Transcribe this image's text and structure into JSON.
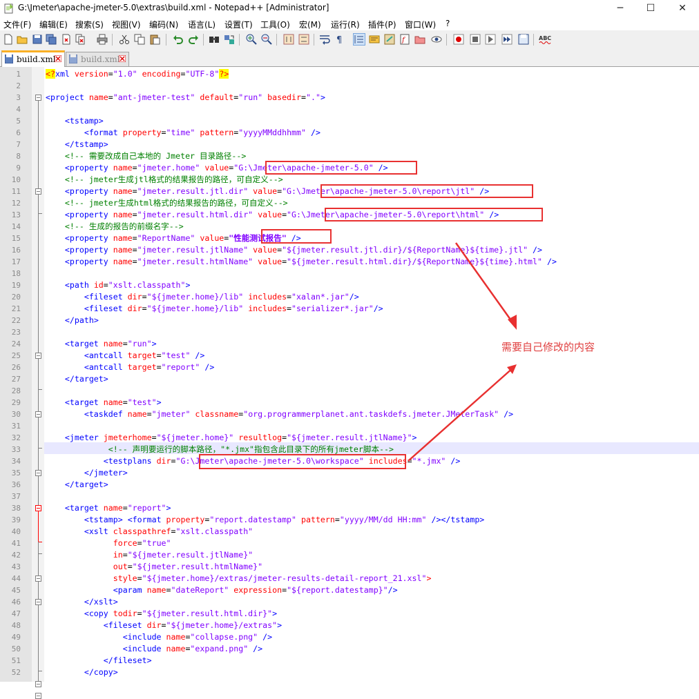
{
  "window": {
    "title": "G:\\Jmeter\\apache-jmeter-5.0\\extras\\build.xml - Notepad++ [Administrator]",
    "minimize_glyph": "─",
    "maximize_glyph": "☐",
    "close_glyph": "✕"
  },
  "menu": [
    "文件(F)",
    "编辑(E)",
    "搜索(S)",
    "视图(V)",
    "编码(N)",
    "语言(L)",
    "设置(T)",
    "工具(O)",
    "宏(M)",
    "运行(R)",
    "插件(P)",
    "窗口(W)",
    "?"
  ],
  "toolbar_icons": [
    "new-file-icon",
    "open-file-icon",
    "save-icon",
    "save-all-icon",
    "close-icon",
    "close-all-icon",
    "print-icon",
    "cut-icon",
    "copy-icon",
    "paste-icon",
    "undo-icon",
    "redo-icon",
    "find-icon",
    "replace-icon",
    "zoom-in-icon",
    "zoom-out-icon",
    "sync-vertical-icon",
    "sync-horizontal-icon",
    "word-wrap-icon",
    "show-all-chars-icon",
    "indent-guide-icon",
    "user-language-icon",
    "doc-map-icon",
    "function-list-icon",
    "folder-workspace-icon",
    "monitoring-icon",
    "macro-record-icon",
    "macro-stop-icon",
    "macro-play-icon",
    "macro-run-multiple-icon",
    "macro-save-icon",
    "spell-check-icon"
  ],
  "tabs": [
    {
      "label": "build.xml",
      "active": true
    },
    {
      "label": "build.xml",
      "active": false
    }
  ],
  "annotation": "需要自己修改的内容",
  "colors": {
    "tag": "#0000ff",
    "attr": "#ff0000",
    "value": "#8000ff",
    "comment": "#008000",
    "highlight_box": "#e83030",
    "current_line": "#e8e8ff"
  },
  "lines": [
    {
      "n": "1",
      "text": "<?xml version=\"1.0\" encoding=\"UTF-8\"?>"
    },
    {
      "n": "2",
      "text": ""
    },
    {
      "n": "3",
      "text": "<project name=\"ant-jmeter-test\" default=\"run\" basedir=\".\">"
    },
    {
      "n": "4",
      "text": ""
    },
    {
      "n": "5",
      "text": "    <tstamp>"
    },
    {
      "n": "6",
      "text": "        <format property=\"time\" pattern=\"yyyyMMddhhmm\" />"
    },
    {
      "n": "7",
      "text": "    </tstamp>"
    },
    {
      "n": "8",
      "text": "    <!-- 需要改成自己本地的 Jmeter 目录路径-->"
    },
    {
      "n": "9",
      "text": "    <property name=\"jmeter.home\" value=\"G:\\Jmeter\\apache-jmeter-5.0\" />"
    },
    {
      "n": "10",
      "text": "    <!-- jmeter生成jtl格式的结果报告的路径，可自定义-->"
    },
    {
      "n": "11",
      "text": "    <property name=\"jmeter.result.jtl.dir\" value=\"G:\\Jmeter\\apache-jmeter-5.0\\report\\jtl\" />"
    },
    {
      "n": "12",
      "text": "    <!-- jmeter生成html格式的结果报告的路径，可自定义-->"
    },
    {
      "n": "13",
      "text": "    <property name=\"jmeter.result.html.dir\" value=\"G:\\Jmeter\\apache-jmeter-5.0\\report\\html\" />"
    },
    {
      "n": "14",
      "text": "    <!-- 生成的报告的前缀名字-->"
    },
    {
      "n": "15",
      "text": "    <property name=\"ReportName\" value=\"性能测试报告\" />"
    },
    {
      "n": "16",
      "text": "    <property name=\"jmeter.result.jtlName\" value=\"${jmeter.result.jtl.dir}/${ReportName}${time}.jtl\" />"
    },
    {
      "n": "17",
      "text": "    <property name=\"jmeter.result.htmlName\" value=\"${jmeter.result.html.dir}/${ReportName}${time}.html\" />"
    },
    {
      "n": "18",
      "text": ""
    },
    {
      "n": "19",
      "text": "    <path id=\"xslt.classpath\">"
    },
    {
      "n": "20",
      "text": "        <fileset dir=\"${jmeter.home}/lib\" includes=\"xalan*.jar\"/>"
    },
    {
      "n": "21",
      "text": "        <fileset dir=\"${jmeter.home}/lib\" includes=\"serializer*.jar\"/>"
    },
    {
      "n": "22",
      "text": "    </path>"
    },
    {
      "n": "23",
      "text": ""
    },
    {
      "n": "24",
      "text": "    <target name=\"run\">"
    },
    {
      "n": "25",
      "text": "        <antcall target=\"test\" />"
    },
    {
      "n": "26",
      "text": "        <antcall target=\"report\" />"
    },
    {
      "n": "27",
      "text": "    </target>"
    },
    {
      "n": "28",
      "text": ""
    },
    {
      "n": "29",
      "text": "    <target name=\"test\">"
    },
    {
      "n": "30",
      "text": "        <taskdef name=\"jmeter\" classname=\"org.programmerplanet.ant.taskdefs.jmeter.JMeterTask\" />"
    },
    {
      "n": "31",
      "text": ""
    },
    {
      "n": "32",
      "text": "    <jmeter jmeterhome=\"${jmeter.home}\" resultlog=\"${jmeter.result.jtlName}\">"
    },
    {
      "n": "33",
      "text": "             <!-- 声明要运行的脚本路径，\"*.jmx\"指包含此目录下的所有jmeter脚本-->"
    },
    {
      "n": "34",
      "text": "            <testplans dir=\"G:\\Jmeter\\apache-jmeter-5.0\\workspace\" includes=\"*.jmx\" />"
    },
    {
      "n": "35",
      "text": "        </jmeter>"
    },
    {
      "n": "36",
      "text": "    </target>"
    },
    {
      "n": "37",
      "text": ""
    },
    {
      "n": "38",
      "text": "    <target name=\"report\">"
    },
    {
      "n": "39",
      "text": "        <tstamp> <format property=\"report.datestamp\" pattern=\"yyyy/MM/dd HH:mm\" /></tstamp>"
    },
    {
      "n": "40",
      "text": "        <xslt classpathref=\"xslt.classpath\""
    },
    {
      "n": "41",
      "text": "              force=\"true\""
    },
    {
      "n": "42",
      "text": "              in=\"${jmeter.result.jtlName}\""
    },
    {
      "n": "43",
      "text": "              out=\"${jmeter.result.htmlName}\""
    },
    {
      "n": "44",
      "text": "              style=\"${jmeter.home}/extras/jmeter-results-detail-report_21.xsl\">"
    },
    {
      "n": "45",
      "text": "              <param name=\"dateReport\" expression=\"${report.datestamp}\"/>"
    },
    {
      "n": "46",
      "text": "        </xslt>"
    },
    {
      "n": "47",
      "text": "        <copy todir=\"${jmeter.result.html.dir}\">"
    },
    {
      "n": "48",
      "text": "            <fileset dir=\"${jmeter.home}/extras\">"
    },
    {
      "n": "49",
      "text": "                <include name=\"collapse.png\" />"
    },
    {
      "n": "50",
      "text": "                <include name=\"expand.png\" />"
    },
    {
      "n": "51",
      "text": "            </fileset>"
    },
    {
      "n": "52",
      "text": "        </copy>"
    }
  ]
}
